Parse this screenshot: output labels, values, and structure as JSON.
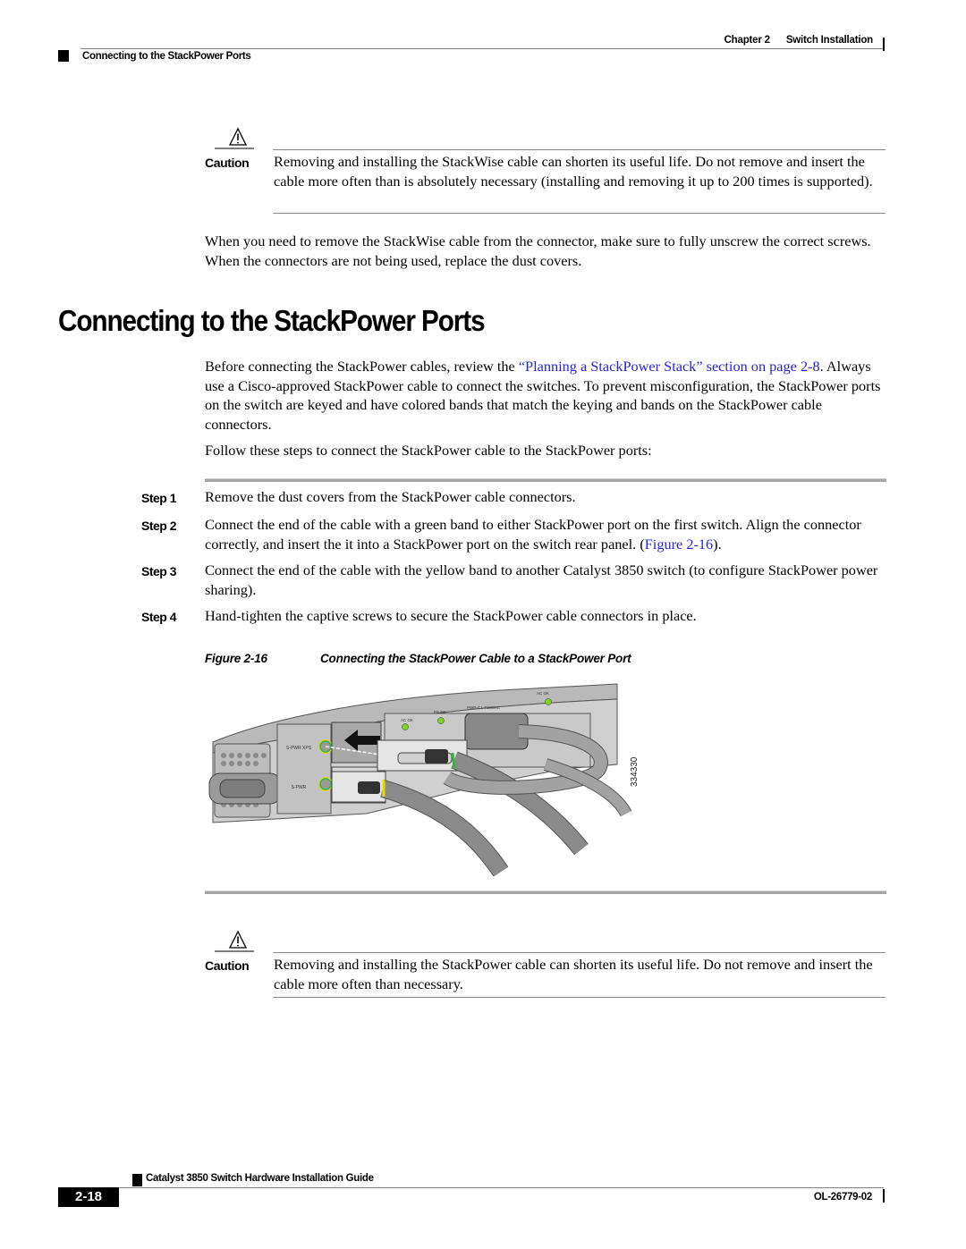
{
  "header": {
    "chapter": "Chapter 2",
    "chapter_title": "Switch Installation",
    "section": "Connecting to the StackPower Ports"
  },
  "caution1": {
    "icon": "warning-triangle-icon",
    "label": "Caution",
    "text": "Removing and installing the StackWise cable can shorten its useful life. Do not remove and insert the cable more often than is absolutely necessary (installing and removing it up to 200 times is supported)."
  },
  "para_remove": "When you need to remove the StackWise cable from the connector, make sure to fully unscrew the correct screws. When the connectors are not being used, replace the dust covers.",
  "section_heading": "Connecting to the StackPower Ports",
  "intro": {
    "before_link": "Before connecting the StackPower cables, review the ",
    "link": "“Planning a StackPower Stack” section on page 2-8",
    "after_link": ". Always use a Cisco-approved StackPower cable to connect the switches. To prevent misconfiguration, the StackPower ports on the switch are keyed and have colored bands that match the keying and bands on the StackPower cable connectors."
  },
  "follow_text": "Follow these steps to connect the StackPower cable to the StackPower ports:",
  "steps": [
    {
      "label": "Step 1",
      "text": "Remove the dust covers from the StackPower cable connectors."
    },
    {
      "label": "Step 2",
      "text_before": "Connect the end of the cable with a green band to either StackPower port on the first switch. Align the connector correctly, and insert the it into a StackPower port on the switch rear panel. (",
      "link": "Figure 2-16",
      "text_after": ")."
    },
    {
      "label": "Step 3",
      "text": "Connect the end of the cable with the yellow band to another Catalyst 3850 switch (to configure StackPower power sharing)."
    },
    {
      "label": "Step 4",
      "text": "Hand-tighten the captive screws to secure the StackPower cable connectors in place."
    }
  ],
  "figure": {
    "number": "Figure 2-16",
    "title": "Connecting the StackPower Cable to a StackPower Port",
    "labels": {
      "ac_ok_1": "AC OK",
      "ps_ok": "PS OK",
      "model": "PWR-C1-715WAC",
      "ac_ok_2": "AC OK",
      "spwr_xps": "S-PWR XPS",
      "spwr": "S-PWR",
      "figure_id": "334330"
    },
    "colors": {
      "green_band": "#3cb043",
      "yellow_band": "#e8d800",
      "led": "#7ed321"
    }
  },
  "caution2": {
    "icon": "warning-triangle-icon",
    "label": "Caution",
    "text": "Removing and installing the StackPower cable can shorten its useful life. Do not remove and insert the cable more often than necessary."
  },
  "footer": {
    "guide_title": "Catalyst 3850 Switch Hardware Installation Guide",
    "page": "2-18",
    "doc_number": "OL-26779-02"
  }
}
